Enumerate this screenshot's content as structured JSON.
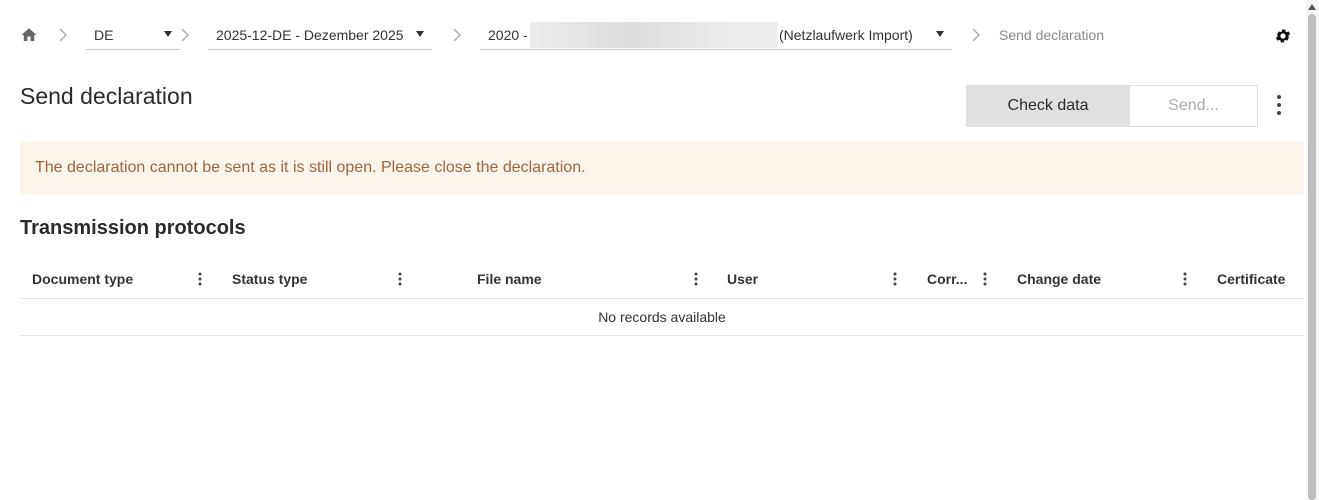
{
  "breadcrumb": {
    "country": "DE",
    "period": "2025-12-DE - Dezember 2025",
    "declaration_prefix": "2020 -",
    "declaration_suffix": "(Netzlaufwerk Import)",
    "current": "Send declaration"
  },
  "page": {
    "title": "Send declaration",
    "check_button": "Check data",
    "send_button": "Send..."
  },
  "banner": {
    "message": "The declaration cannot be sent as it is still open. Please close the declaration."
  },
  "protocols": {
    "title": "Transmission protocols",
    "columns": [
      "Document type",
      "Status type",
      "File name",
      "User",
      "Corr...",
      "Change date",
      "Certificate"
    ],
    "empty_message": "No records available"
  },
  "colors": {
    "banner_bg": "#fdf4ec",
    "banner_text": "#a0653a",
    "check_button_bg": "#e0e0e0"
  },
  "icons": [
    "home-icon",
    "chevron-right-icon",
    "dropdown-arrow-icon",
    "gear-icon",
    "more-vertical-icon"
  ]
}
